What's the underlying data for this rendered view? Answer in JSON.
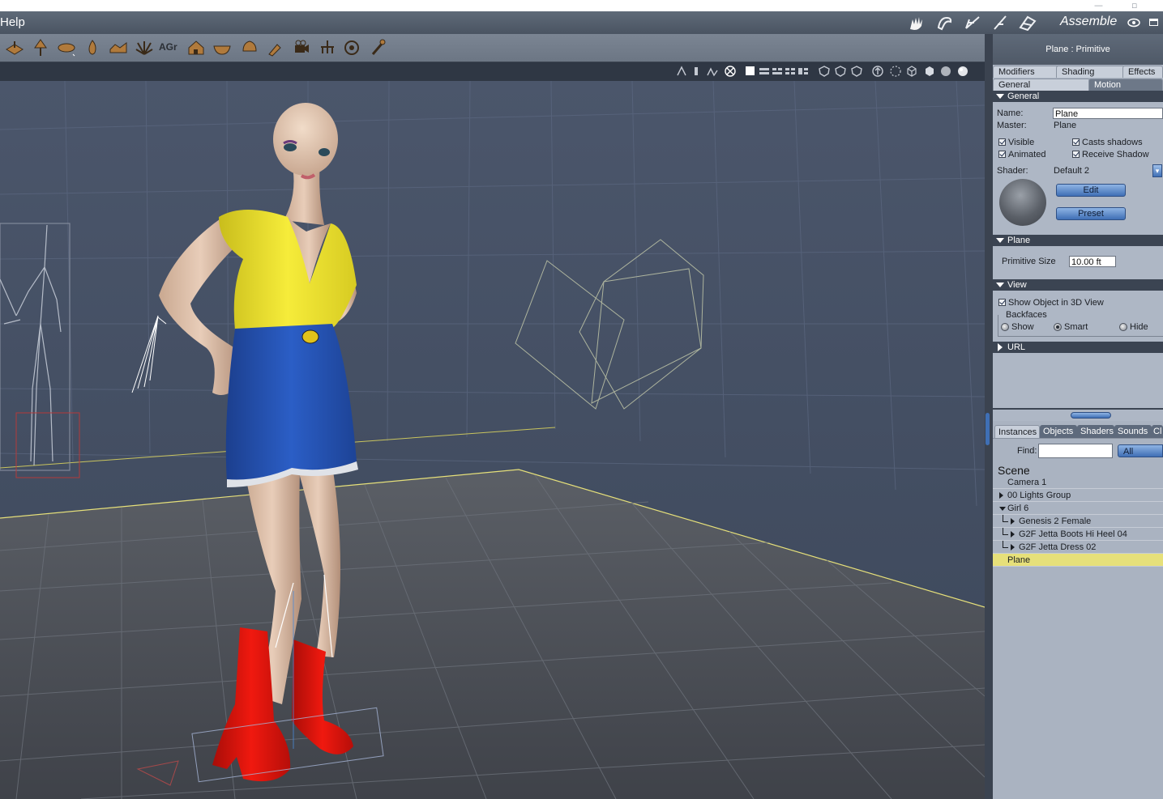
{
  "menu": {
    "help": "Help"
  },
  "rooms": {
    "active_label": "Assemble"
  },
  "toolbar": {
    "agr_label": "AGr"
  },
  "panel": {
    "title": "Plane : Primitive",
    "tabs_row1": [
      "Modifiers",
      "Shading",
      "Effects"
    ],
    "tabs_row2": [
      "General",
      "Motion"
    ],
    "general": {
      "header": "General",
      "name_label": "Name:",
      "name_value": "Plane",
      "master_label": "Master:",
      "master_value": "Plane",
      "visible": "Visible",
      "casts_shadows": "Casts shadows",
      "animated": "Animated",
      "receive_shadow": "Receive Shadow",
      "shader_label": "Shader:",
      "shader_value": "Default 2",
      "edit_button": "Edit",
      "preset_button": "Preset"
    },
    "plane": {
      "header": "Plane",
      "primitive_size_label": "Primitive Size",
      "primitive_size_value": "10.00 ft"
    },
    "view": {
      "header": "View",
      "show_object": "Show Object in 3D View",
      "backfaces_label": "Backfaces",
      "show": "Show",
      "smart": "Smart",
      "hide": "Hide"
    },
    "url": {
      "header": "URL"
    }
  },
  "browser": {
    "tabs": [
      "Instances",
      "Objects",
      "Shaders",
      "Sounds",
      "Cl"
    ],
    "find_label": "Find:",
    "filter_value": "All",
    "scene_title": "Scene",
    "tree": [
      {
        "label": "Camera 1",
        "indent": 0,
        "toggle": "none",
        "selected": false
      },
      {
        "label": "00 Lights Group",
        "indent": 0,
        "toggle": "right",
        "selected": false
      },
      {
        "label": "Girl 6",
        "indent": 0,
        "toggle": "down",
        "selected": false
      },
      {
        "label": "Genesis 2 Female",
        "indent": 1,
        "toggle": "right",
        "selected": false
      },
      {
        "label": "G2F Jetta Boots Hi Heel 04",
        "indent": 1,
        "toggle": "right",
        "selected": false
      },
      {
        "label": "G2F Jetta Dress 02",
        "indent": 1,
        "toggle": "right",
        "selected": false
      },
      {
        "label": "Plane",
        "indent": 0,
        "toggle": "none",
        "selected": true
      }
    ]
  },
  "colors": {
    "selection": "#e6e07a",
    "accent_blue": "#3f6fb5",
    "dress_top": "#f2e62a",
    "dress_skirt": "#2553b8",
    "boots": "#e3150f"
  }
}
